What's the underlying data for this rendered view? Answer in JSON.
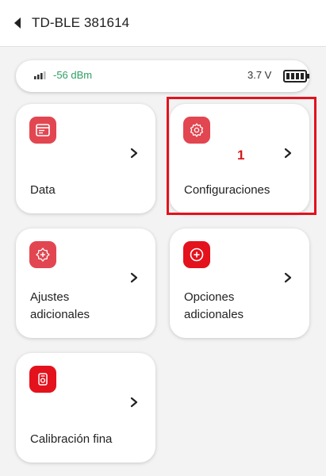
{
  "header": {
    "title": "TD-BLE 381614"
  },
  "status": {
    "signal": "-56 dBm",
    "voltage": "3.7 V",
    "signal_color": "#2f9e63"
  },
  "cards": [
    {
      "label": "Data",
      "icon": "browser-window-icon"
    },
    {
      "label": "Configuraciones",
      "icon": "gear-icon"
    },
    {
      "label": "Ajustes\nadicionales",
      "icon": "star-gear-icon"
    },
    {
      "label": "Opciones\nadicionales",
      "icon": "plus-circle-icon"
    },
    {
      "label": "Calibración fina",
      "icon": "calibration-device-icon"
    }
  ],
  "annotation": {
    "number": "1"
  },
  "colors": {
    "accent": "#e24650",
    "highlight": "#e3121c"
  }
}
